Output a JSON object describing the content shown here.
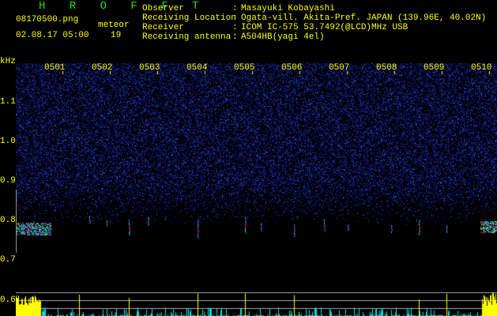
{
  "app_title": "H R O F F T",
  "file_name": "08170500.png",
  "datetime": "02.08.17 05:00",
  "meteor_label": "meteor",
  "meteor_count": "19",
  "info": [
    {
      "label": "Observer",
      "value": "Masayuki Kobayashi"
    },
    {
      "label": "Receiving Location",
      "value": "Ogata-vill. Akita-Pref. JAPAN (139.96E, 40.02N)"
    },
    {
      "label": "Receiver",
      "value": "ICOM IC-575 53.7492(@LCD)MHz USB"
    },
    {
      "label": "Receiving antenna",
      "value": "A504HB(yagi 4el)"
    }
  ],
  "separator": ":",
  "y_axis": {
    "unit": "kHz",
    "ticks": [
      "1.1",
      "1.0",
      "0.9",
      "0.8",
      "0.7",
      "0.6"
    ]
  },
  "x_axis": {
    "ticks": [
      "0501",
      "0502",
      "0503",
      "0504",
      "0505",
      "0506",
      "0507",
      "0508",
      "0509",
      "0510"
    ]
  },
  "colors": {
    "text": "#ffff00",
    "title": "#22dd22",
    "noise": "#2030c0",
    "histogram_meteor": "#ffff00",
    "histogram_noise": "#00e0e0"
  }
}
